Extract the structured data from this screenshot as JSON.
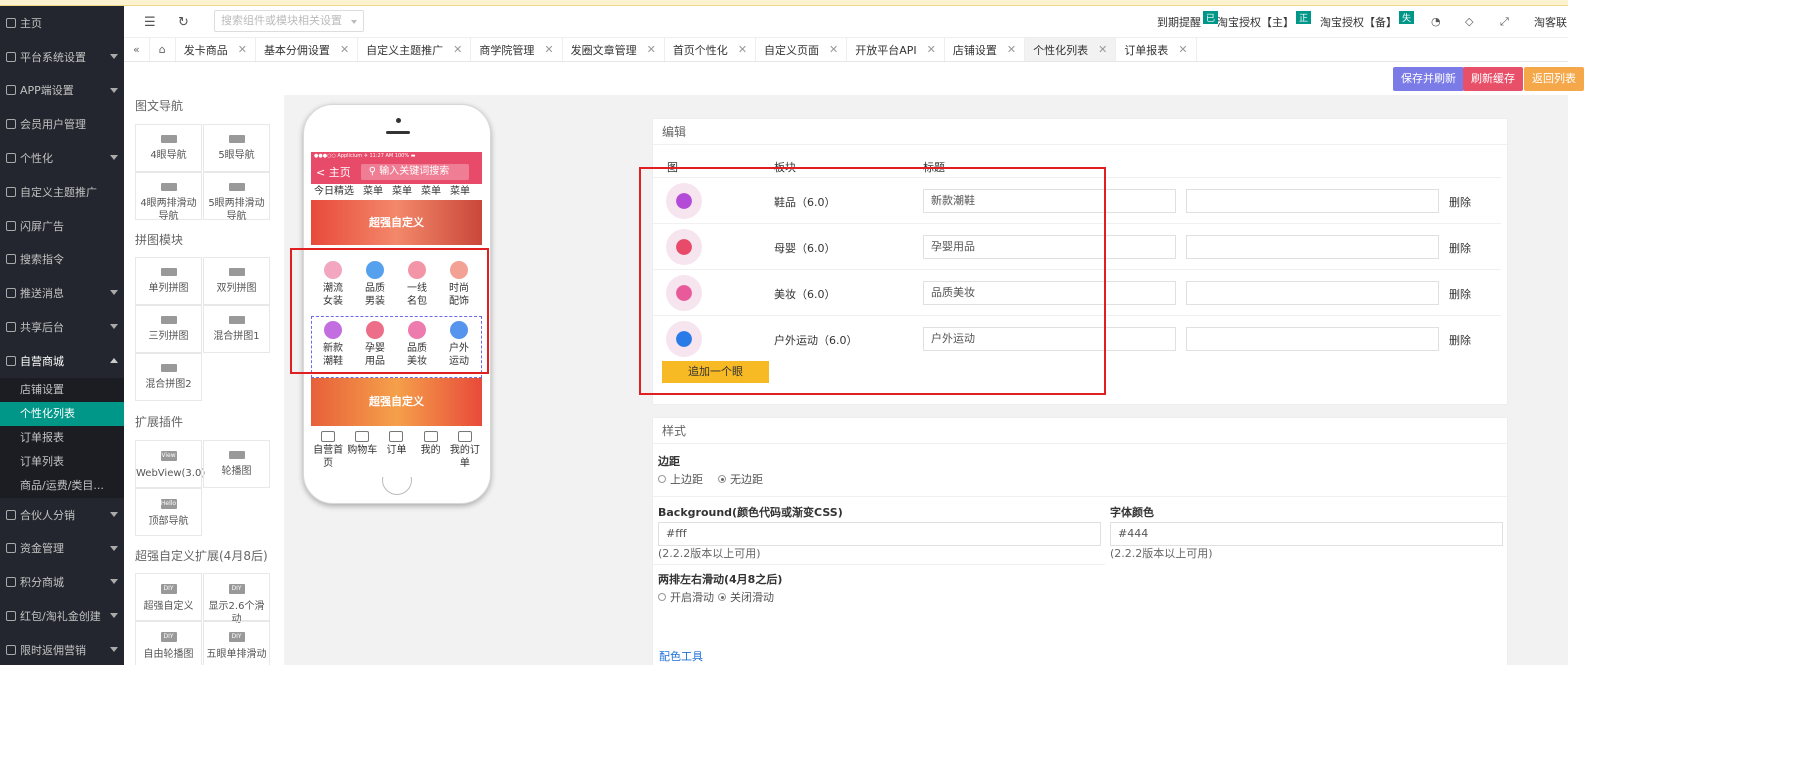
{
  "sidebar": {
    "items": [
      {
        "label": "主页",
        "caret": false
      },
      {
        "label": "平台系统设置",
        "caret": true
      },
      {
        "label": "APP端设置",
        "caret": true
      },
      {
        "label": "会员用户管理",
        "caret": false
      },
      {
        "label": "个性化",
        "caret": true
      },
      {
        "label": "自定义主题推广",
        "caret": false
      },
      {
        "label": "闪屏广告",
        "caret": false
      },
      {
        "label": "搜索指令",
        "caret": false
      },
      {
        "label": "推送消息",
        "caret": true
      },
      {
        "label": "共享后台",
        "caret": true
      },
      {
        "label": "自营商城",
        "caret": true
      }
    ],
    "sub_items": [
      "店铺设置",
      "个性化列表",
      "订单报表",
      "订单列表",
      "商品/运费/类目..."
    ],
    "active_sub": "个性化列表",
    "items_after": [
      {
        "label": "合伙人分销"
      },
      {
        "label": "资金管理"
      },
      {
        "label": "积分商城"
      },
      {
        "label": "红包/淘礼金创建"
      },
      {
        "label": "限时返佣营销"
      }
    ]
  },
  "header": {
    "search_placeholder": "搜索组件或模块相关设置",
    "expire_label": "到期提醒",
    "expire_badge": "已",
    "taobao_main": "淘宝授权【主】",
    "taobao_main_badge": "正",
    "taobao_backup": "淘宝授权【备】",
    "taobao_backup_badge": "失",
    "account": "淘客联"
  },
  "tabs": [
    "发卡商品",
    "基本分佣设置",
    "自定义主题推广",
    "商学院管理",
    "发圈文章管理",
    "首页个性化",
    "自定义页面",
    "开放平台API",
    "店铺设置",
    "个性化列表",
    "订单报表"
  ],
  "active_tab": "个性化列表",
  "actions": {
    "save_refresh": "保存并刷新",
    "refresh_cache": "刷新缓存",
    "back_list": "返回列表"
  },
  "components": {
    "sec1": "图文导航",
    "sec1_items": [
      "4眼导航",
      "5眼导航",
      "4眼两排滑动导航",
      "5眼两排滑动导航"
    ],
    "sec2": "拼图模块",
    "sec2_items": [
      "单列拼图",
      "双列拼图",
      "三列拼图",
      "混合拼图1",
      "混合拼图2"
    ],
    "sec3": "扩展插件",
    "sec3_items": [
      "WebView(3.0)",
      "轮播图",
      "顶部导航"
    ],
    "sec3_thumbs": [
      "View",
      "",
      "Hello"
    ],
    "sec4": "超强自定义扩展(4月8后)",
    "sec4_items": [
      "超强自定义",
      "显示2.6个滑动",
      "自由轮播图",
      "五眼单排滑动"
    ],
    "sec4_thumb": "DIY"
  },
  "phone": {
    "status": "●●●○○ Applicium ✈   11:27 AM   100% ▬",
    "back": "< 主页",
    "search": "输入关键词搜索",
    "categories": [
      "今日精选",
      "菜单",
      "菜单",
      "菜单",
      "菜单"
    ],
    "banner1": "超强自定义",
    "banner2": "超强自定义",
    "nav_row1": [
      {
        "l1": "潮流",
        "l2": "女装"
      },
      {
        "l1": "品质",
        "l2": "男装"
      },
      {
        "l1": "一线",
        "l2": "名包"
      },
      {
        "l1": "时尚",
        "l2": "配饰"
      }
    ],
    "nav_row2": [
      {
        "l1": "新款",
        "l2": "潮鞋"
      },
      {
        "l1": "孕婴",
        "l2": "用品"
      },
      {
        "l1": "品质",
        "l2": "美妆"
      },
      {
        "l1": "户外",
        "l2": "运动"
      }
    ],
    "tabbar": [
      "自营首页",
      "购物车",
      "订单",
      "我的",
      "我的订单"
    ]
  },
  "edit": {
    "title": "编辑",
    "col_icon": "图",
    "col_block": "板块",
    "col_title": "标题",
    "rows": [
      {
        "name": "鞋品（6.0）",
        "title": "新款潮鞋",
        "extra": "",
        "delete": "删除",
        "color": "#b34ad8"
      },
      {
        "name": "母婴（6.0）",
        "title": "孕婴用品",
        "extra": "",
        "delete": "删除",
        "color": "#e84a6a"
      },
      {
        "name": "美妆（6.0）",
        "title": "品质美妆",
        "extra": "",
        "delete": "删除",
        "color": "#e85a9a"
      },
      {
        "name": "户外运动（6.0）",
        "title": "户外运动",
        "extra": "",
        "delete": "删除",
        "color": "#2a7ae8"
      }
    ],
    "add_button": "追加一个眼"
  },
  "style": {
    "title": "样式",
    "margin_label": "边距",
    "margin_options": [
      "上边距",
      "无边距"
    ],
    "margin_selected": "无边距",
    "bg_label": "Background(颜色代码或渐变CSS)",
    "bg_value": "#fff",
    "bg_hint": "(2.2.2版本以上可用)",
    "font_color_label": "字体颜色",
    "font_color_value": "#444",
    "font_color_hint": "(2.2.2版本以上可用)",
    "scroll_label": "两排左右滑动(4月8之后)",
    "scroll_options": [
      "开启滑动",
      "关闭滑动"
    ],
    "scroll_selected": "关闭滑动",
    "color_tool": "配色工具"
  }
}
